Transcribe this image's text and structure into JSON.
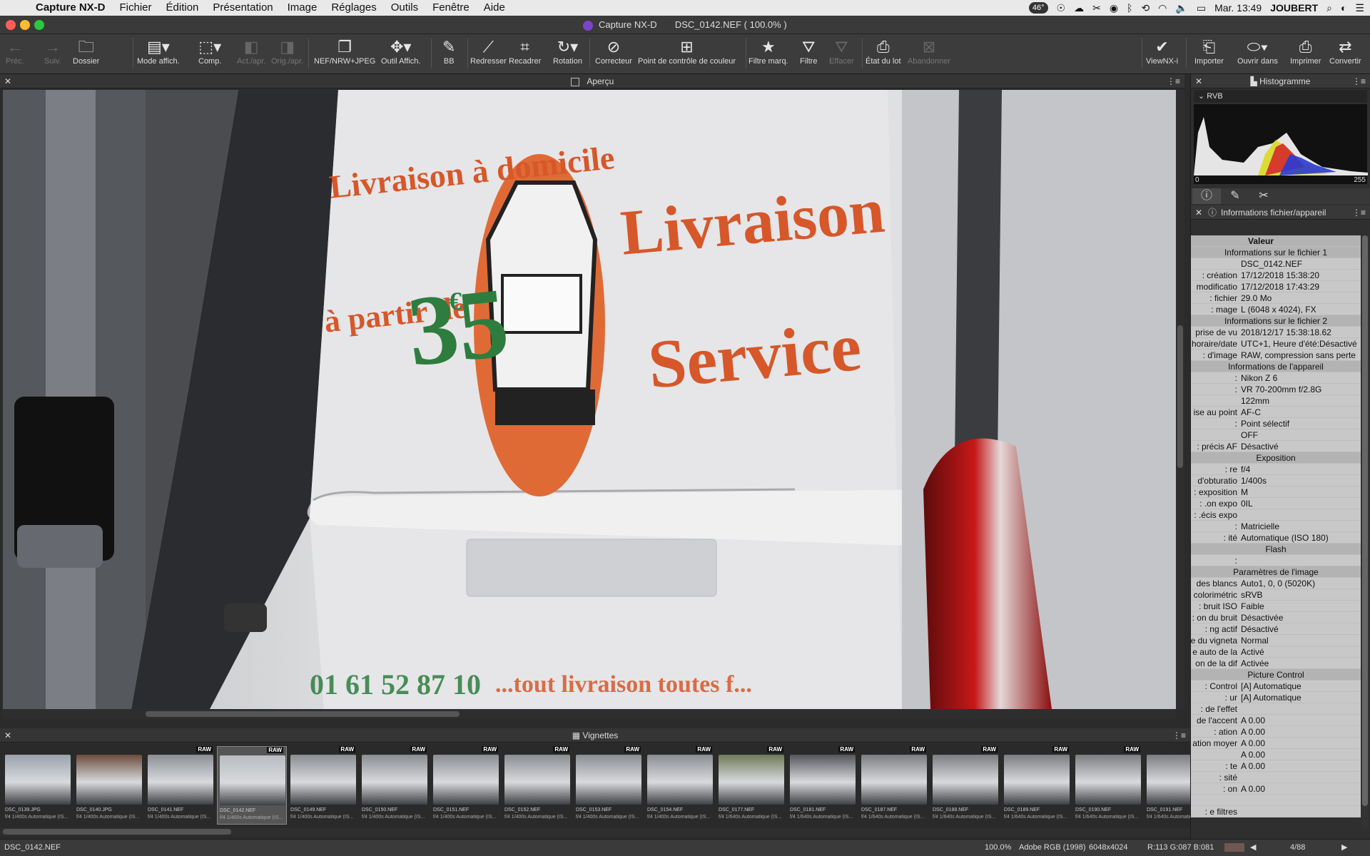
{
  "menubar": {
    "app": "Capture NX-D",
    "items": [
      "Fichier",
      "Édition",
      "Présentation",
      "Image",
      "Réglages",
      "Outils",
      "Fenêtre",
      "Aide"
    ],
    "temp": "46°",
    "clock": "Mar. 13:49",
    "user": "JOUBERT"
  },
  "window": {
    "app": "Capture NX-D",
    "file": "DSC_0142.NEF ( 100.0% )"
  },
  "toolbar": {
    "prev": "Préc.",
    "next": "Suiv.",
    "folder": "Dossier",
    "viewmode": "Mode affich.",
    "compare": "Comp.",
    "before_after": "Act./apr.",
    "orig_after": "Orig./apr.",
    "nefjpeg": "NEF/NRW+JPEG",
    "viewtool": "Outil Affich.",
    "wb": "BB",
    "straighten": "Redresser",
    "crop": "Recadrer",
    "rotate": "Rotation",
    "corrector": "Correcteur",
    "ccp": "Point de contrôle de couleur",
    "label_filter": "Filtre marq.",
    "filter": "Filtre",
    "clear": "Effacer",
    "batch": "État du lot",
    "abandon": "Abandonner",
    "viewnxi": "ViewNX-i",
    "import": "Importer",
    "open_in": "Ouvrir dans",
    "print": "Imprimer",
    "convert": "Convertir"
  },
  "preview": {
    "title": "Aperçu",
    "van_text": {
      "line1": "Livraison à domicile",
      "line2": "à partir de",
      "price": "35",
      "currency": "€",
      "brand1": "Livraison",
      "brand2": "Service",
      "phone": "01 61 52 87 10",
      "footer": "...tout livraison toutes f..."
    }
  },
  "histogram": {
    "title": "Histogramme",
    "channel": "RVB",
    "min": "0",
    "max": "255"
  },
  "info": {
    "title": "Informations fichier/appareil",
    "header": "Valeur",
    "rows": [
      {
        "sec": "Informations sur le fichier 1"
      },
      {
        "k": "",
        "v": "DSC_0142.NEF"
      },
      {
        "k": "création :",
        "v": "17/12/2018 15:38:20"
      },
      {
        "k": "modificatio",
        "v": "17/12/2018 17:43:29"
      },
      {
        "k": "fichier :",
        "v": "29.0 Mo"
      },
      {
        "k": "mage :",
        "v": "L (6048 x 4024), FX"
      },
      {
        "sec": "Informations sur le fichier 2"
      },
      {
        "k": "prise de vu",
        "v": "2018/12/17 15:38:18.62"
      },
      {
        "k": "horaire/date",
        "v": "UTC+1, Heure d'été:Désactivé"
      },
      {
        "k": "d'image :",
        "v": "RAW, compression sans perte"
      },
      {
        "sec": "Informations de l'appareil"
      },
      {
        "k": ":",
        "v": "Nikon Z 6"
      },
      {
        "k": ":",
        "v": "VR 70-200mm f/2.8G"
      },
      {
        "k": "",
        "v": "122mm"
      },
      {
        "k": "ise au point",
        "v": "AF-C"
      },
      {
        "k": ":",
        "v": "Point sélectif"
      },
      {
        "k": "",
        "v": "OFF"
      },
      {
        "k": "précis AF :",
        "v": "Désactivé"
      },
      {
        "sec": "Exposition"
      },
      {
        "k": "re :",
        "v": "f/4"
      },
      {
        "k": "d'obturatio",
        "v": "1/400s"
      },
      {
        "k": "exposition :",
        "v": "M"
      },
      {
        "k": "on expo. :",
        "v": "0IL"
      },
      {
        "k": "écis expo. :",
        "v": ""
      },
      {
        "k": ":",
        "v": "Matricielle"
      },
      {
        "k": "ité :",
        "v": "Automatique (ISO 180)"
      },
      {
        "sec": "Flash"
      },
      {
        "k": ":",
        "v": ""
      },
      {
        "sec": "Paramètres de l'image"
      },
      {
        "k": "des blancs",
        "v": "Auto1, 0, 0 (5020K)"
      },
      {
        "k": "colorimétric",
        "v": "sRVB"
      },
      {
        "k": "bruit ISO :",
        "v": "Faible"
      },
      {
        "k": "on du bruit :",
        "v": "Désactivée"
      },
      {
        "k": "ng actif :",
        "v": "Désactivé"
      },
      {
        "k": "e du vigneta",
        "v": "Normal"
      },
      {
        "k": "e auto de la",
        "v": "Activé"
      },
      {
        "k": "on de la dif",
        "v": "Activée"
      },
      {
        "sec": "Picture Control"
      },
      {
        "k": "Control :",
        "v": "[A] Automatique"
      },
      {
        "k": "ur :",
        "v": "[A] Automatique"
      },
      {
        "k": "de l'effet :",
        "v": ""
      },
      {
        "k": "de l'accent",
        "v": "A 0.00"
      },
      {
        "k": "ation :",
        "v": "A 0.00"
      },
      {
        "k": "ation moyer",
        "v": "A 0.00"
      },
      {
        "k": "",
        "v": "A 0.00"
      },
      {
        "k": "te :",
        "v": "A 0.00"
      },
      {
        "k": "sité :",
        "v": ""
      },
      {
        "k": "on :",
        "v": "A 0.00"
      },
      {
        "k": "",
        "v": ""
      },
      {
        "k": "e filtres :",
        "v": ""
      }
    ]
  },
  "film": {
    "title": "Vignettes",
    "thumbs": [
      {
        "fn": "DSC_0139.JPG",
        "meta": "f/4 1/400s Automatique (IS...",
        "raw": "",
        "c": "#9aa2ad"
      },
      {
        "fn": "DSC_0140.JPG",
        "meta": "f/4 1/400s Automatique (IS...",
        "raw": "",
        "c": "#6b4b3c"
      },
      {
        "fn": "DSC_0141.NEF",
        "meta": "f/4 1/400s Automatique (IS...",
        "raw": "RAW",
        "c": "#8b8f95"
      },
      {
        "fn": "DSC_0142.NEF",
        "meta": "f/4 1/400s Automatique (IS...",
        "raw": "RAW",
        "c": "#b9bcc0"
      },
      {
        "fn": "DSC_0149.NEF",
        "meta": "f/4 1/400s Automatique (IS...",
        "raw": "RAW",
        "c": "#8a8d92"
      },
      {
        "fn": "DSC_0150.NEF",
        "meta": "f/4 1/400s Automatique (IS...",
        "raw": "RAW",
        "c": "#8a8d92"
      },
      {
        "fn": "DSC_0151.NEF",
        "meta": "f/4 1/400s Automatique (IS...",
        "raw": "RAW",
        "c": "#8a8d92"
      },
      {
        "fn": "DSC_0152.NEF",
        "meta": "f/4 1/400s Automatique (IS...",
        "raw": "RAW",
        "c": "#8a8d92"
      },
      {
        "fn": "DSC_0153.NEF",
        "meta": "f/4 1/400s Automatique (IS...",
        "raw": "RAW",
        "c": "#8a8d92"
      },
      {
        "fn": "DSC_0154.NEF",
        "meta": "f/4 1/400s Automatique (IS...",
        "raw": "RAW",
        "c": "#8a8d92"
      },
      {
        "fn": "DSC_0177.NEF",
        "meta": "f/4 1/640s Automatique (IS...",
        "raw": "RAW",
        "c": "#6f7a58"
      },
      {
        "fn": "DSC_0181.NEF",
        "meta": "f/4 1/640s Automatique (IS...",
        "raw": "RAW",
        "c": "#55565b"
      },
      {
        "fn": "DSC_0187.NEF",
        "meta": "f/4 1/640s Automatique (IS...",
        "raw": "RAW",
        "c": "#7b7d80"
      },
      {
        "fn": "DSC_0188.NEF",
        "meta": "f/4 1/640s Automatique (IS...",
        "raw": "RAW",
        "c": "#7b7d80"
      },
      {
        "fn": "DSC_0189.NEF",
        "meta": "f/4 1/640s Automatique (IS...",
        "raw": "RAW",
        "c": "#7b7d80"
      },
      {
        "fn": "DSC_0190.NEF",
        "meta": "f/4 1/640s Automatique (IS...",
        "raw": "RAW",
        "c": "#7b7d80"
      },
      {
        "fn": "DSC_0191.NEF",
        "meta": "f/4 1/640s Automatique (IS...",
        "raw": "RAW",
        "c": "#7b7d80"
      }
    ]
  },
  "status": {
    "file": "DSC_0142.NEF",
    "zoom": "100.0%",
    "profile": "Adobe RGB (1998)",
    "size": "6048x4024",
    "rgb": "R:113 G:087 B:081",
    "count": "4/88"
  }
}
